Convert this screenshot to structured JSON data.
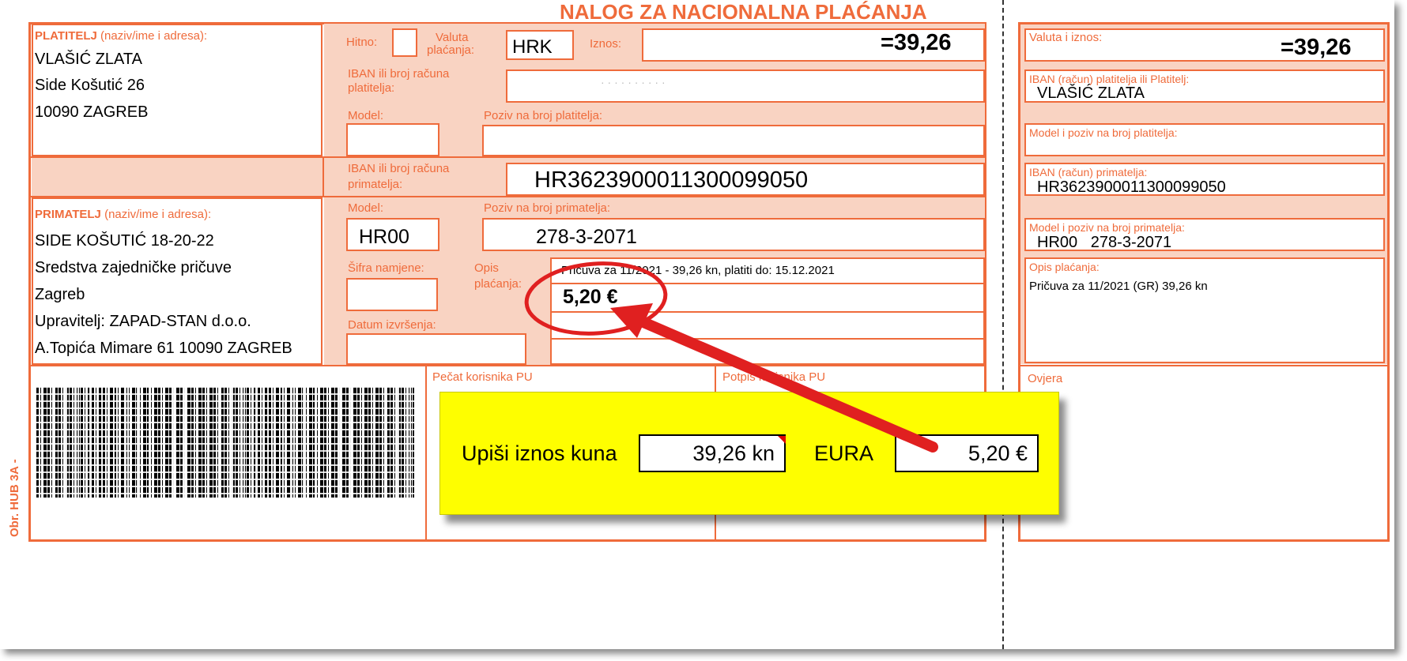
{
  "form": {
    "title": "NALOG ZA NACIONALNA PLAĆANJA",
    "side_code": "Obr. HUB 3A -",
    "platitelj": {
      "label_bold": "PLATITELJ",
      "label_rest": " (naziv/ime i adresa):",
      "lines": [
        "VLAŠIĆ ZLATA",
        "Side Košutić 26",
        "10090 ZAGREB"
      ]
    },
    "hitno_label": "Hitno:",
    "valuta_label_1": "Valuta",
    "valuta_label_2": "plaćanja:",
    "valuta_value": "HRK",
    "iznos_label": "Iznos:",
    "iznos_value": "=39,26",
    "iban_platitelja_label_1": "IBAN ili broj računa",
    "iban_platitelja_label_2": "platitelja:",
    "iban_platitelja_value": "· · · · · · · · · ·",
    "model_label": "Model:",
    "poziv_platitelja_label": "Poziv na broj platitelja:",
    "iban_primatelja_label_1": "IBAN ili broj računa",
    "iban_primatelja_label_2": "primatelja:",
    "iban_primatelja_value": "HR3623900011300099050",
    "primatelj": {
      "label_bold": "PRIMATELJ",
      "label_rest": " (naziv/ime i adresa):",
      "lines": [
        "SIDE KOŠUTIĆ 18-20-22",
        " Sredstva zajedničke pričuve",
        "Zagreb",
        "Upravitelj: ZAPAD-STAN d.o.o.",
        "A.Topića Mimare 61 10090 ZAGREB"
      ]
    },
    "model2_label": "Model:",
    "poziv_primatelja_label": "Poziv na broj primatelja:",
    "model2_value": "HR00",
    "poziv_primatelja_value": "278-3-2071",
    "sifra_label": "Šifra namjene:",
    "opis_label_1": "Opis",
    "opis_label_2": "plaćanja:",
    "opis_line1": "Pričuva za 11/2021 - 39,26 kn,  platiti do: 15.12.2021",
    "opis_line2": "5,20 €",
    "datum_label": "Datum izvršenja:",
    "pecat_label": "Pečat korisnika PU",
    "potpis_label": "Potpis korisnika PU"
  },
  "receipt": {
    "valuta_label": "Valuta i iznos:",
    "iznos_value": "=39,26",
    "iban_platitelja_label": "IBAN (račun) platitelja ili Platitelj:",
    "iban_platitelja_value": "VLAŠIĆ ZLATA",
    "model_poziv_platitelja_label": "Model i poziv na broj platitelja:",
    "iban_primatelja_label": "IBAN (račun) primatelja:",
    "iban_primatelja_value": "HR3623900011300099050",
    "model_poziv_primatelja_label": "Model i poziv na broj primatelja:",
    "model_poziv_primatelja_value": "HR00   278-3-2071",
    "opis_label": "Opis plaćanja:",
    "opis_value": "Pričuva za 11/2021 (GR) 39,26 kn",
    "ovjera_label": "Ovjera"
  },
  "converter": {
    "prompt_label": "Upiši iznos kuna",
    "kuna_value": "39,26 kn",
    "eura_label": "EURA",
    "eur_value": "5,20 €"
  },
  "colors": {
    "form_orange": "#ef6b3b",
    "field_fill": "#f9d3c2",
    "highlight_yellow": "#fefe00",
    "annotation_red": "#e02020"
  }
}
